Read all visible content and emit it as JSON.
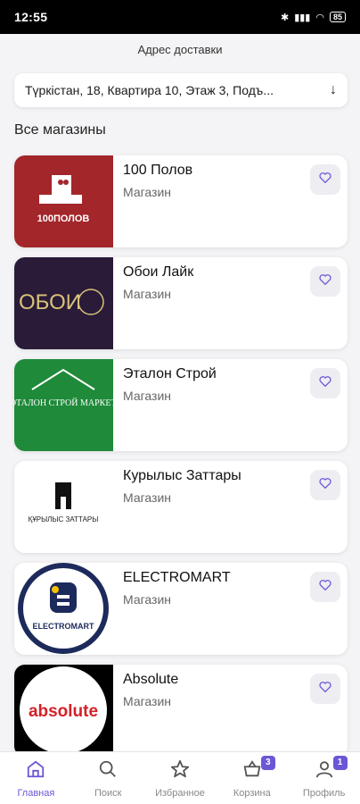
{
  "status": {
    "time": "12:55",
    "battery": "85"
  },
  "header": {
    "title": "Адрес доставки"
  },
  "address": {
    "value": "Түркістан, 18, Квартира 10, Этаж 3, Подъ..."
  },
  "section": {
    "title": "Все магазины"
  },
  "stores": [
    {
      "name": "100 Полов",
      "type": "Магазин",
      "logo_text": "100ПОЛОВ"
    },
    {
      "name": "Обои Лайк",
      "type": "Магазин",
      "logo_text": "ОБОИ"
    },
    {
      "name": "Эталон Строй",
      "type": "Магазин",
      "logo_text": "ЭТАЛОН СТРОЙ МАРКЕТ"
    },
    {
      "name": "Курылыс Заттары",
      "type": "Магазин",
      "logo_text": "ҚҰРЫЛЫС ЗАТТАРЫ"
    },
    {
      "name": "ELECTROMART",
      "type": "Магазин",
      "logo_text": "ELECTROMART"
    },
    {
      "name": "Absolute",
      "type": "Магазин",
      "logo_text": "absolute"
    }
  ],
  "nav": [
    {
      "label": "Главная"
    },
    {
      "label": "Поиск"
    },
    {
      "label": "Избранное"
    },
    {
      "label": "Корзина",
      "badge": "3"
    },
    {
      "label": "Профиль",
      "badge": "1"
    }
  ],
  "colors": {
    "accent": "#6b57d6"
  }
}
